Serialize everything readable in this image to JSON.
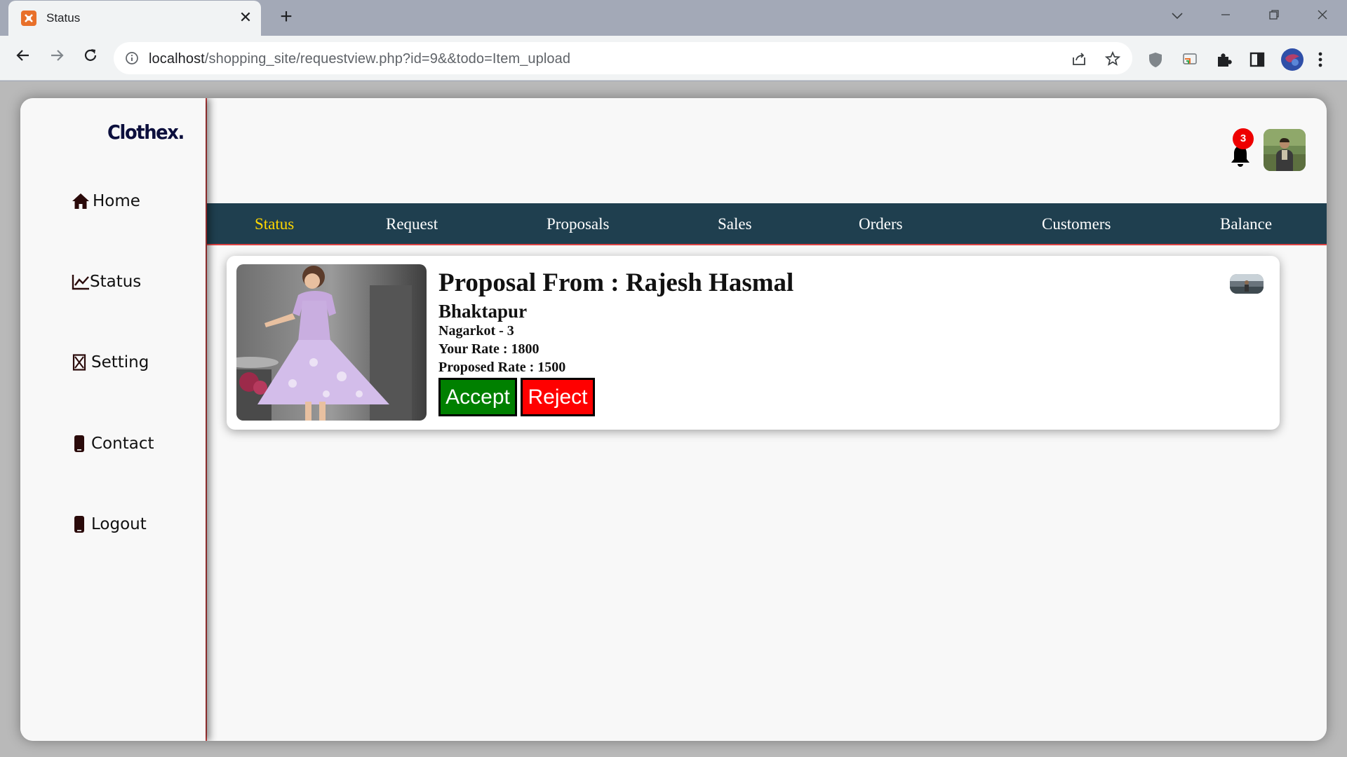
{
  "browser": {
    "tab_title": "Status",
    "tab_close": "✕",
    "new_tab": "+",
    "url_host": "localhost",
    "url_path": "/shopping_site/requestview.php?id=9&&todo=Item_upload"
  },
  "sidebar": {
    "logo": "Clothex.",
    "items": [
      {
        "label": "Home",
        "icon": "home-icon"
      },
      {
        "label": "Status",
        "icon": "chart-line-icon"
      },
      {
        "label": "Setting",
        "icon": "setting-icon"
      },
      {
        "label": "Contact",
        "icon": "phone-icon"
      },
      {
        "label": "Logout",
        "icon": "phone-icon"
      }
    ]
  },
  "header": {
    "notification_count": "3"
  },
  "topnav": {
    "items": [
      {
        "label": "Status",
        "active": true
      },
      {
        "label": "Request"
      },
      {
        "label": "Proposals"
      },
      {
        "label": "Sales"
      },
      {
        "label": "Orders"
      },
      {
        "label": "Customers"
      },
      {
        "label": "Balance"
      }
    ]
  },
  "proposal": {
    "title": "Proposal From : Rajesh Hasmal",
    "city": "Bhaktapur",
    "address": "Nagarkot - 3",
    "your_rate": "Your Rate : 1800",
    "proposed_rate": "Proposed Rate : 1500",
    "accept_label": "Accept",
    "reject_label": "Reject"
  },
  "colors": {
    "nav_bg": "#1f3f4f",
    "nav_active": "#ffd700",
    "accept": "#008000",
    "reject": "#ff0000",
    "badge": "#ee0000"
  }
}
